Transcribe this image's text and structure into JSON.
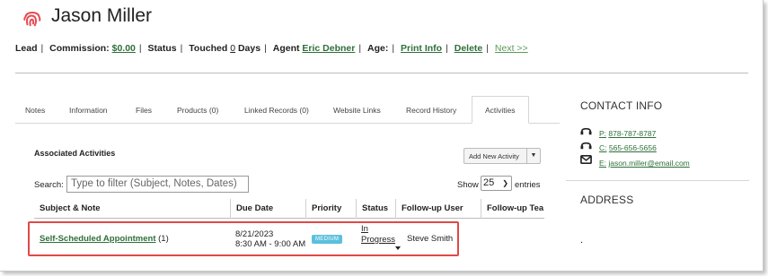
{
  "header": {
    "name": "Jason Miller",
    "meta": {
      "lead_label": "Lead",
      "commission_label": "Commission:",
      "commission_value": "$0.00",
      "status_label": "Status",
      "touched_label": "Touched",
      "touched_value": "0",
      "touched_unit": "Days",
      "agent_label": "Agent",
      "agent_value": "Eric Debner",
      "age_label": "Age:",
      "print_label": "Print Info",
      "delete_label": "Delete",
      "next_label": "Next >>"
    }
  },
  "tabs": [
    {
      "label": "Notes"
    },
    {
      "label": "Information"
    },
    {
      "label": "Files"
    },
    {
      "label": "Products (0)"
    },
    {
      "label": "Linked Records (0)"
    },
    {
      "label": "Website Links"
    },
    {
      "label": "Record History"
    },
    {
      "label": "Activities",
      "active": true
    }
  ],
  "activities": {
    "title": "Associated Activities",
    "add_button": "Add New Activity",
    "search_label": "Search:",
    "search_placeholder": "Type to filter (Subject, Notes, Dates)",
    "show_label": "Show",
    "show_value": "25",
    "entries_label": "entries",
    "columns": [
      "Subject & Note",
      "Due Date",
      "Priority",
      "Status",
      "Follow-up User",
      "Follow-up Tea"
    ],
    "rows": [
      {
        "subject": "Self-Scheduled Appointment",
        "count": "(1)",
        "due_date": "8/21/2023",
        "due_time": "8:30 AM - 9:00 AM",
        "priority": "MEDIUM",
        "status_line1": "In",
        "status_line2": "Progress",
        "followup_user": "Steve Smith"
      }
    ]
  },
  "contact": {
    "title": "CONTACT INFO",
    "phone_prefix": "P:",
    "phone": "878-787-8787",
    "cell_prefix": "C:",
    "cell": "565-656-5656",
    "email_prefix": "E:",
    "email": "jason.miller@email.com"
  },
  "address": {
    "title": "ADDRESS",
    "value": "."
  },
  "colors": {
    "accent_red": "#e04848",
    "link_green": "#2f6f3a",
    "badge_blue": "#5bc0de"
  },
  "icons": {
    "brand": "fingerprint-icon",
    "phone": "headset-icon",
    "cell": "headset-icon",
    "email": "envelope-icon"
  }
}
